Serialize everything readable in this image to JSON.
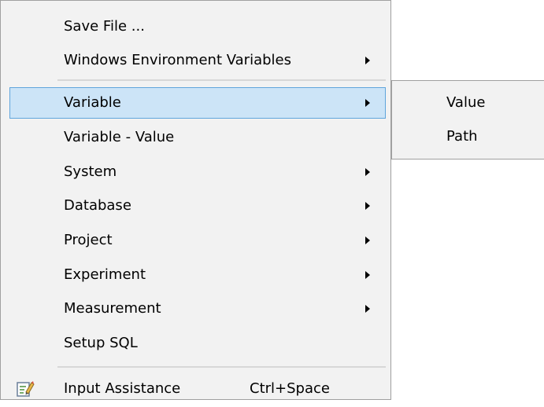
{
  "context_menu": {
    "items": [
      {
        "label": "Save File ...",
        "submenu": false
      },
      {
        "label": "Windows Environment Variables",
        "submenu": true
      },
      {
        "label": "Variable",
        "submenu": true,
        "highlighted": true
      },
      {
        "label": "Variable - Value",
        "submenu": false
      },
      {
        "label": "System",
        "submenu": true
      },
      {
        "label": "Database",
        "submenu": true
      },
      {
        "label": "Project",
        "submenu": true
      },
      {
        "label": "Experiment",
        "submenu": true
      },
      {
        "label": "Measurement",
        "submenu": true
      },
      {
        "label": "Setup SQL",
        "submenu": false
      },
      {
        "label": "Input Assistance",
        "shortcut": "Ctrl+Space",
        "icon": "edit-note-icon"
      }
    ]
  },
  "submenu": {
    "items": [
      {
        "label": "Value"
      },
      {
        "label": "Path"
      }
    ]
  },
  "colors": {
    "menu_background": "#f2f2f2",
    "highlight_fill": "#cce4f7",
    "highlight_border": "#5fa5dc",
    "border": "#a0a0a0"
  }
}
